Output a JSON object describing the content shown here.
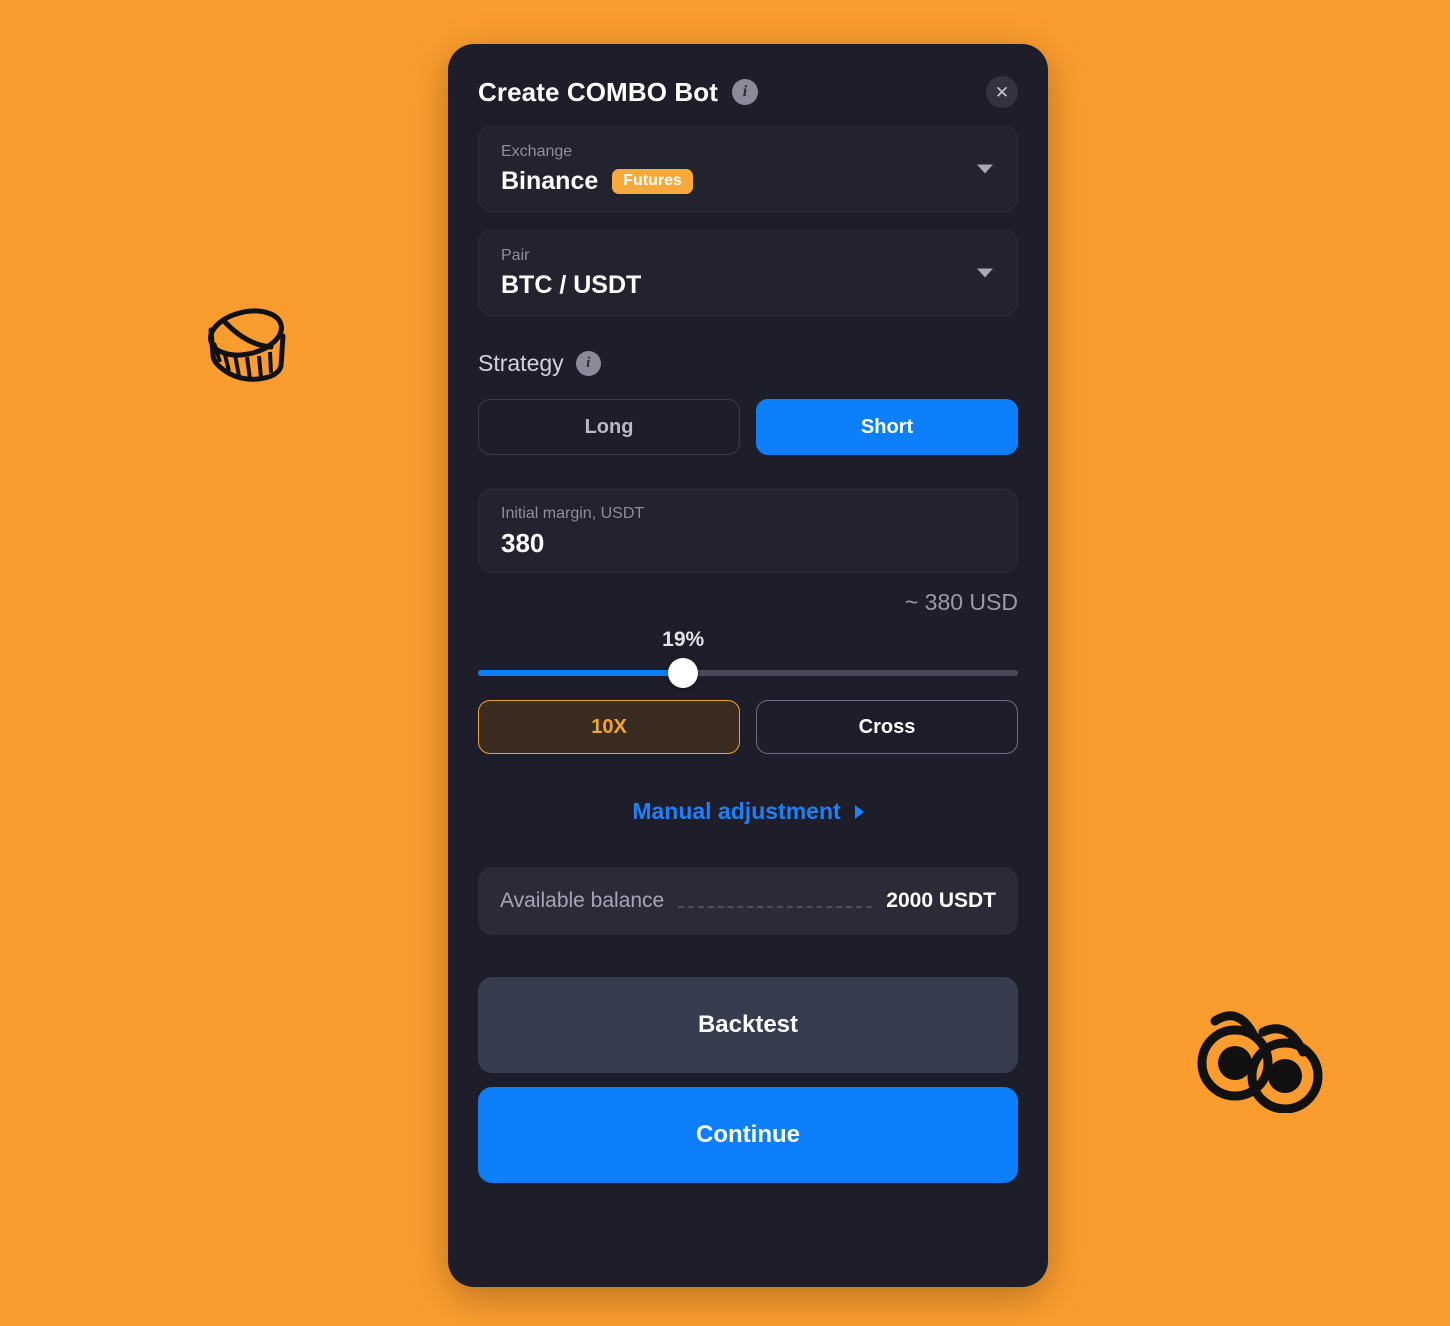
{
  "page": {
    "background_color": "#FB9D2E",
    "accent_blue": "#0D7FFB",
    "accent_orange": "#F3A436"
  },
  "decorations": [
    {
      "name": "coin-doodle",
      "label": "coin"
    },
    {
      "name": "eyes-doodle",
      "label": "eyes"
    }
  ],
  "modal": {
    "title": "Create COMBO Bot",
    "title_info_icon": "info-icon",
    "close_icon": "close-icon",
    "exchange": {
      "label": "Exchange",
      "value": "Binance",
      "badge": "Futures",
      "badge_color": "#F8A93C",
      "chevron": "chevron-down-icon"
    },
    "pair": {
      "label": "Pair",
      "value": "BTC / USDT",
      "chevron": "chevron-down-icon"
    },
    "strategy": {
      "title": "Strategy",
      "info_icon": "info-icon",
      "options": [
        {
          "label": "Long",
          "selected": false
        },
        {
          "label": "Short",
          "selected": true
        }
      ]
    },
    "margin": {
      "label": "Initial margin, USDT",
      "value": "380",
      "placeholder": "0",
      "approx": "~ 380 USD"
    },
    "slider": {
      "percent_label": "19%",
      "percent": 19,
      "thumb_position_pct": 38,
      "fill_color": "#0D7FFB",
      "track_color": "#4A4A58"
    },
    "leverage": {
      "value": "10X",
      "margin_mode": "Cross"
    },
    "manual_adjustment": {
      "label": "Manual adjustment",
      "arrow_icon": "arrow-right-icon"
    },
    "balance": {
      "label": "Available balance",
      "value": "2000 USDT"
    },
    "actions": {
      "backtest": "Backtest",
      "continue": "Continue"
    }
  }
}
